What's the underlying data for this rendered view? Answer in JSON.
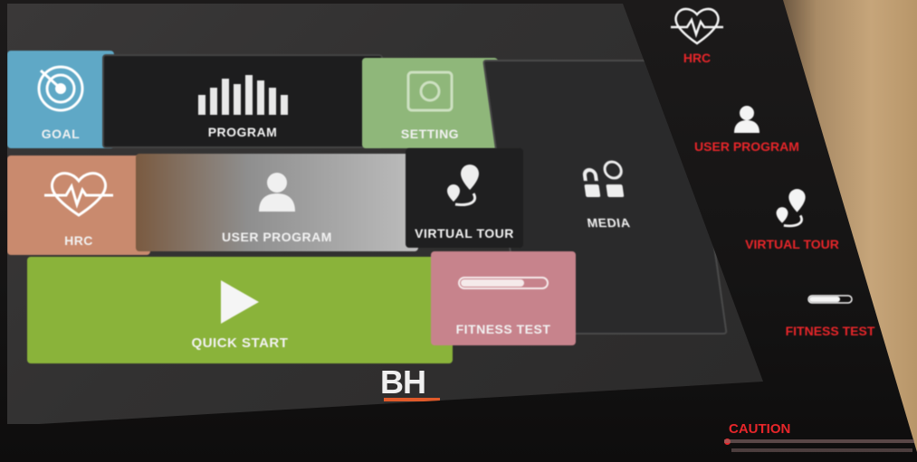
{
  "screen": {
    "tiles": {
      "goal": "GOAL",
      "program": "PROGRAM",
      "setting": "SETTING",
      "hrc": "HRC",
      "user_program": "USER PROGRAM",
      "virtual_tour": "VIRTUAL TOUR",
      "media": "MEDIA",
      "quick_start": "QUICK START",
      "fitness_test": "FITNESS TEST"
    },
    "brand": "BH"
  },
  "side_buttons": {
    "hrc": "HRC",
    "user_program": "USER PROGRAM",
    "virtual_tour": "VIRTUAL TOUR",
    "fitness_test": "FITNESS TEST"
  },
  "caution": {
    "title": "CAUTION"
  },
  "colors": {
    "goal": "#5fa8c6",
    "setting": "#8fb77a",
    "hrc": "#c98a6e",
    "quick_start": "#8ab33a",
    "fitness_test": "#c7838c",
    "accent_red": "#e8262a",
    "brand_orange": "#e05a2a"
  }
}
